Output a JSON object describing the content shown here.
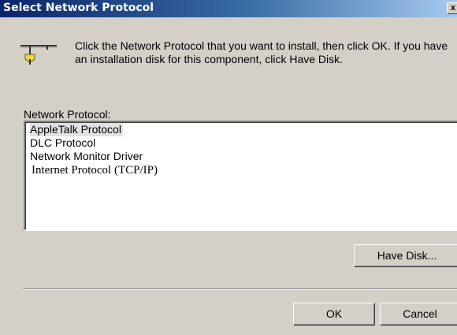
{
  "dialog": {
    "title": "Select Network Protocol",
    "close_label": "x",
    "instructions": "Click the Network Protocol that you want to install, then click OK. If you have an installation disk for this component, click Have Disk.",
    "icon": "network-protocol-icon"
  },
  "protocol_list": {
    "label": "Network Protocol:",
    "items": [
      {
        "label": "AppleTalk Protocol",
        "selected": true
      },
      {
        "label": "DLC Protocol",
        "selected": false
      },
      {
        "label": "Network Monitor Driver",
        "selected": false
      },
      {
        "label": "Internet Protocol (TCP/IP)",
        "selected": false
      }
    ]
  },
  "buttons": {
    "have_disk": "Have Disk...",
    "ok": "OK",
    "cancel": "Cancel"
  },
  "colors": {
    "titlebar_start": "#0a246a",
    "titlebar_end": "#a6caf0",
    "dialog_face": "#d4d0c8",
    "selection": "#e1e1e1"
  }
}
